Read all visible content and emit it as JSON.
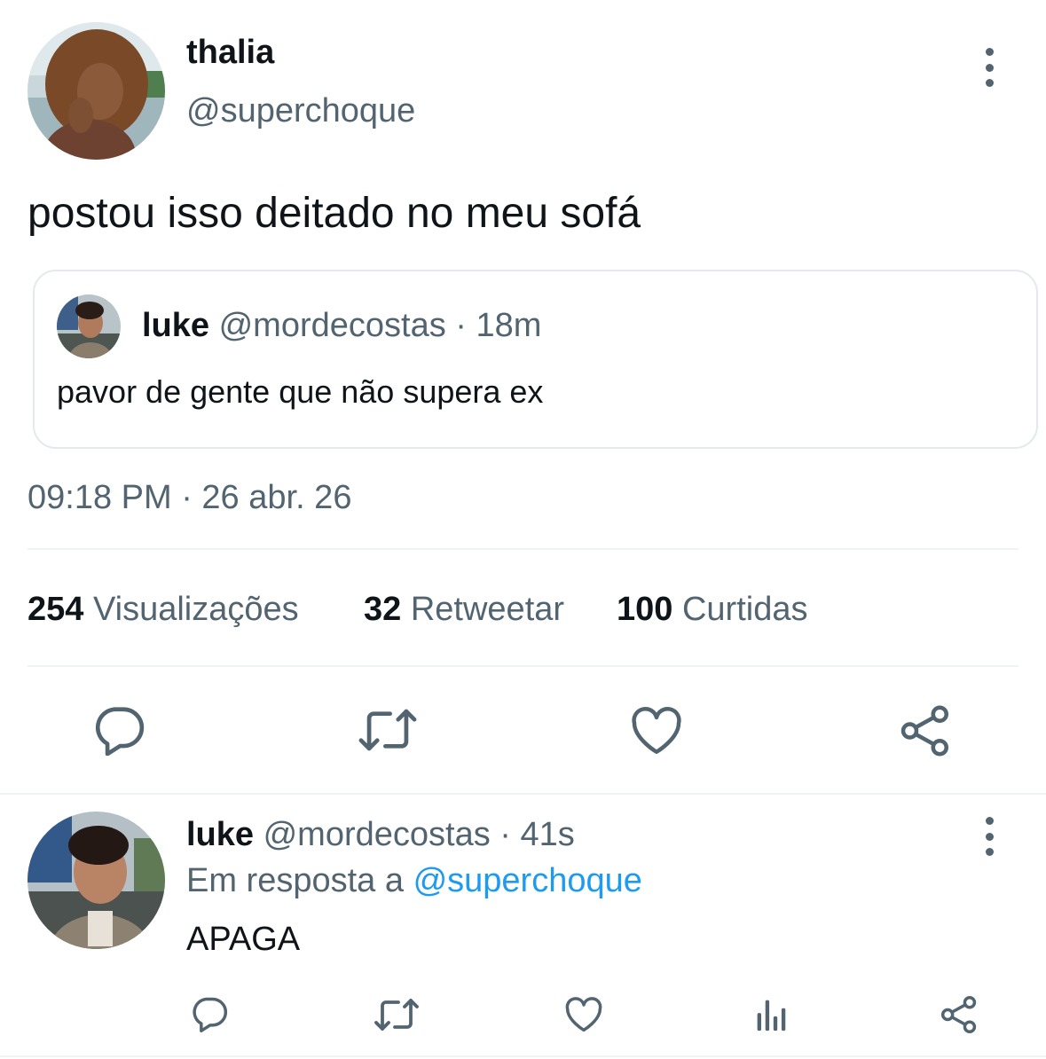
{
  "main_tweet": {
    "author": {
      "display_name": "thalia",
      "handle": "@superchoque"
    },
    "text": "postou isso deitado no meu sofá",
    "quoted": {
      "display_name": "luke",
      "handle": "@mordecostas",
      "separator": "·",
      "time": "18m",
      "text": "pavor de gente que não supera ex"
    },
    "timestamp": "09:18 PM · 26 abr. 26",
    "stats": [
      {
        "count": "254",
        "label": "Visualizações"
      },
      {
        "count": "32",
        "label": "Retweetar"
      },
      {
        "count": "100",
        "label": "Curtidas"
      }
    ],
    "actions": [
      "reply-icon",
      "retweet-icon",
      "like-icon",
      "share-icon"
    ]
  },
  "reply": {
    "display_name": "luke",
    "handle": "@mordecostas",
    "separator": "·",
    "time": "41s",
    "reply_prefix": "Em resposta a",
    "reply_to": "@superchoque",
    "text": "APAGA",
    "actions": [
      "reply-icon",
      "retweet-icon",
      "like-icon",
      "views-icon",
      "share-icon"
    ]
  },
  "colors": {
    "text": "#0f1419",
    "muted": "#536471",
    "link": "#1d9bf0",
    "divider": "#eff3f4"
  }
}
